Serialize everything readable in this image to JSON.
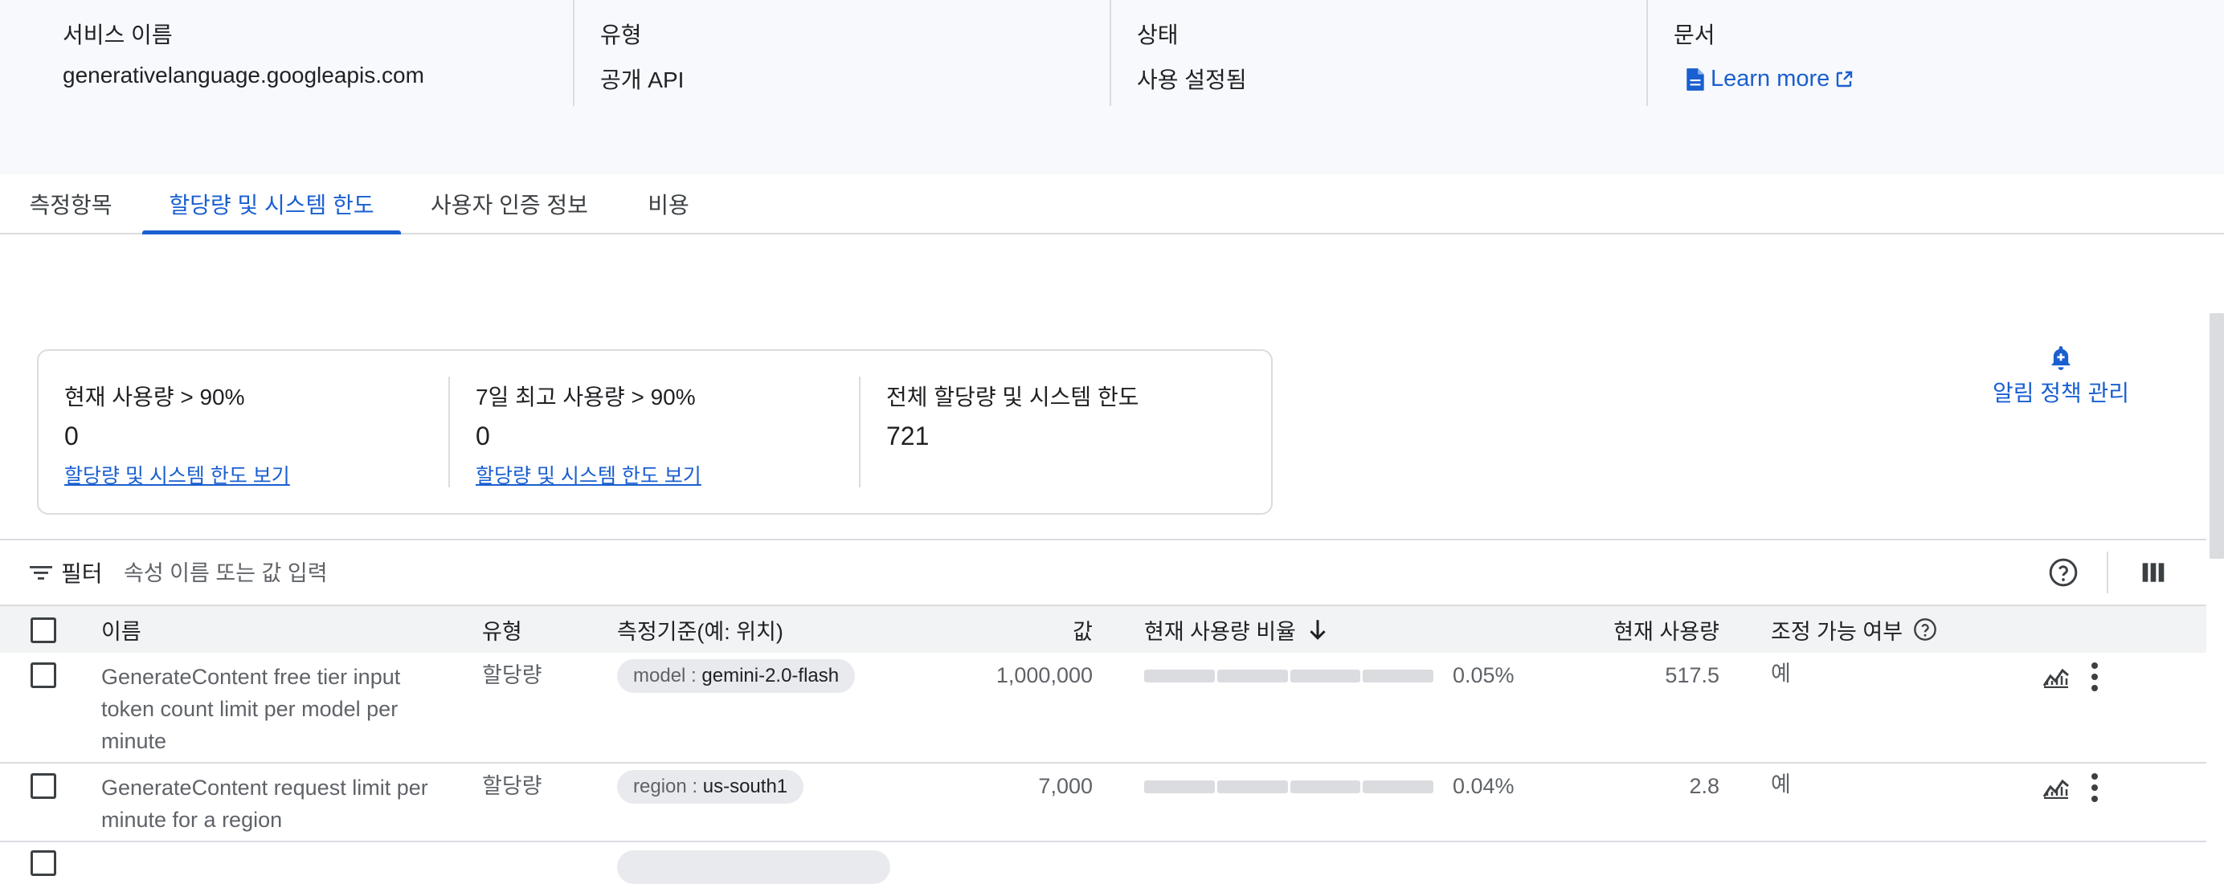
{
  "service_info": {
    "service_name": {
      "label": "서비스 이름",
      "value": "generativelanguage.googleapis.com"
    },
    "type": {
      "label": "유형",
      "value": "공개 API"
    },
    "status": {
      "label": "상태",
      "value": "사용 설정됨"
    },
    "docs": {
      "label": "문서",
      "link": "Learn more",
      "icon": "document-icon",
      "link_icon": "external-link-icon"
    }
  },
  "tabs": [
    {
      "label": "측정항목",
      "active": false
    },
    {
      "label": "할당량 및 시스템 한도",
      "active": true
    },
    {
      "label": "사용자 인증 정보",
      "active": false
    },
    {
      "label": "비용",
      "active": false
    }
  ],
  "summary": [
    {
      "title": "현재 사용량 > 90%",
      "value": "0",
      "link": "할당량 및 시스템 한도 보기"
    },
    {
      "title": "7일 최고 사용량 > 90%",
      "value": "0",
      "link": "할당량 및 시스템 한도 보기"
    },
    {
      "title": "전체 할당량 및 시스템 한도",
      "value": "721"
    }
  ],
  "alert_policy": {
    "label": "알림 정책 관리",
    "icon": "add-alert-icon"
  },
  "filter": {
    "label": "필터",
    "placeholder": "속성 이름 또는 값 입력",
    "icon": "filter-icon",
    "help_icon": "help-icon",
    "columns_icon": "column-picker-icon"
  },
  "table": {
    "headers": {
      "name": "이름",
      "type": "유형",
      "dimension": "측정기준(예: 위치)",
      "value": "값",
      "usage_pct": "현재 사용량 비율",
      "usage": "현재 사용량",
      "adjustable": "조정 가능 여부"
    },
    "sort_icon": "arrow-down-icon",
    "rows": [
      {
        "name": "GenerateContent free tier input token count limit per model per minute",
        "type": "할당량",
        "dim_key": "model :",
        "dim_value": "gemini-2.0-flash",
        "value": "1,000,000",
        "usage_pct": "0.05%",
        "usage_fraction": 0.0005,
        "usage": "517.5",
        "adjustable": "예"
      },
      {
        "name": "GenerateContent request limit per minute for a region",
        "type": "할당량",
        "dim_key": "region :",
        "dim_value": "us-south1",
        "value": "7,000",
        "usage_pct": "0.04%",
        "usage_fraction": 0.0004,
        "usage": "2.8",
        "adjustable": "예"
      }
    ]
  },
  "colors": {
    "accent": "#1a5fd0",
    "border": "#dadce0",
    "header_bg": "#f1f3f4",
    "info_bg": "#f8f9fc"
  }
}
